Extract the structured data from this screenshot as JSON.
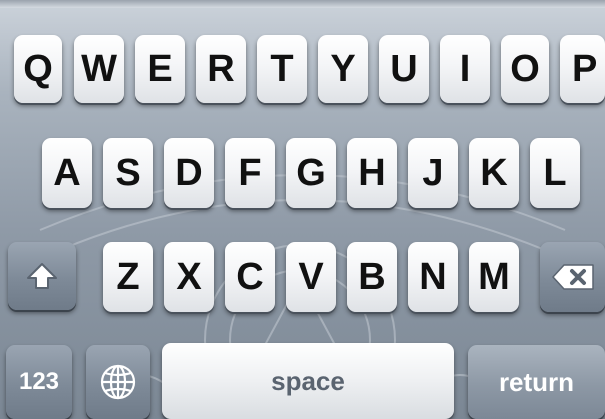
{
  "keyboard": {
    "row1": [
      "Q",
      "W",
      "E",
      "R",
      "T",
      "Y",
      "U",
      "I",
      "O",
      "P"
    ],
    "row2": [
      "A",
      "S",
      "D",
      "F",
      "G",
      "H",
      "J",
      "K",
      "L"
    ],
    "row3": [
      "Z",
      "X",
      "C",
      "V",
      "B",
      "N",
      "M"
    ],
    "numbers_label": "123",
    "space_label": "space",
    "return_label": "return",
    "icons": {
      "shift": "shift-arrow-icon",
      "delete": "delete-backspace-icon",
      "globe": "globe-icon"
    },
    "colors": {
      "key_face": "#f4f5f7",
      "key_text": "#111111",
      "function_key": "#8a96a3",
      "background": "#8f9aa7"
    }
  }
}
